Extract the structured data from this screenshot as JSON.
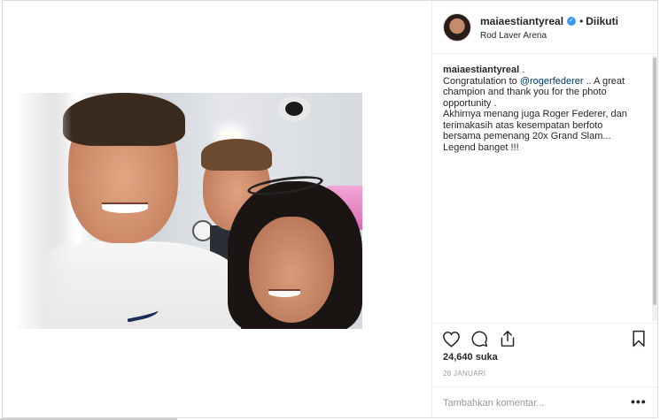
{
  "post": {
    "username": "maiaestiantyreal",
    "verified": true,
    "follow_status": "Diikuti",
    "location": "Rod Laver Arena",
    "caption": {
      "username": "maiaestiantyreal",
      "lines_before_mention": ".",
      "congrats_prefix": "Congratulation to ",
      "mention": "@rogerfederer",
      "congrats_suffix": " .. A great champion and thank you for the photo opportunity .",
      "indonesian_text": "Akhirnya menang juga Roger Federer, dan terimakasih atas kesempatan berfoto bersama pemenang 20x Grand Slam... Legend banget !!!"
    },
    "likes_label": "24,640 suka",
    "date": "28 JANUARI",
    "comment_placeholder": "Tambahkan komentar...",
    "more_label": "•••"
  },
  "icons": {
    "like": "heart-icon",
    "comment": "comment-icon",
    "share": "share-icon",
    "save": "bookmark-icon"
  },
  "colors": {
    "verified_blue": "#3897f0",
    "mention_blue": "#003569",
    "border": "#dbdbdb",
    "muted_text": "#999999"
  }
}
